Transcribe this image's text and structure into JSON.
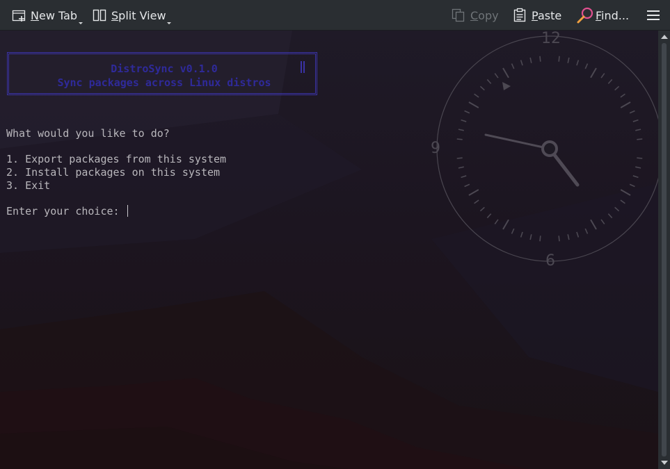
{
  "toolbar": {
    "new_tab": {
      "label": "New Tab",
      "mnemonic": "N",
      "rest": "ew Tab",
      "icon": "new-tab-icon"
    },
    "split_view": {
      "label": "Split View",
      "mnemonic": "S",
      "rest": "plit View",
      "icon": "split-view-icon"
    },
    "copy": {
      "label": "Copy",
      "mnemonic": "C",
      "rest": "opy",
      "icon": "copy-icon",
      "enabled": false
    },
    "paste": {
      "label": "Paste",
      "mnemonic": "P",
      "rest": "aste",
      "icon": "paste-icon"
    },
    "find": {
      "label": "Find...",
      "mnemonic": "F",
      "rest": "ind...",
      "icon": "find-icon"
    },
    "menu": {
      "icon": "hamburger-menu-icon"
    }
  },
  "terminal": {
    "banner": {
      "title": "DistroSync v0.1.0",
      "subtitle": "Sync packages across Linux distros"
    },
    "prompt": "What would you like to do?",
    "options": [
      "1. Export packages from this system",
      "2. Install packages on this system",
      "3. Exit"
    ],
    "input_prompt": "Enter your choice: ",
    "input_value": ""
  },
  "wallpaper_clock": {
    "labels": {
      "twelve": "12",
      "nine": "9",
      "six": "6"
    }
  },
  "colors": {
    "toolbar_bg": "#2a2e32",
    "terminal_text": "#b9b7bc",
    "banner_accent": "#3b33a6"
  }
}
